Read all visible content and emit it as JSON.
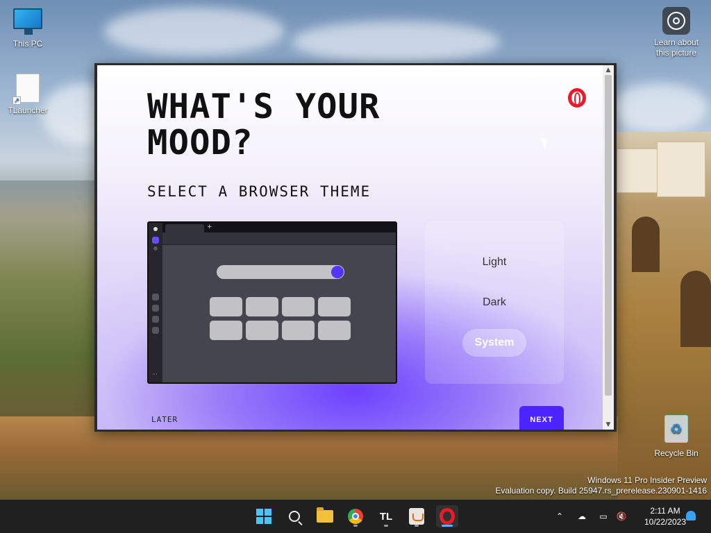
{
  "desktop": {
    "icons": [
      {
        "label": "This PC",
        "icon": "computer-icon"
      },
      {
        "label": "TLauncher",
        "icon": "file-shortcut-icon"
      },
      {
        "label": "Learn about this picture",
        "icon": "camera-info-icon"
      },
      {
        "label": "Recycle Bin",
        "icon": "recycle-bin-icon"
      }
    ],
    "watermark": {
      "line1": "Windows 11 Pro Insider Preview",
      "line2": "Evaluation copy. Build 25947.rs_prerelease.230901-1416"
    }
  },
  "onboarding": {
    "title": "WHAT'S YOUR MOOD?",
    "subtitle": "SELECT A BROWSER THEME",
    "themes": [
      "Light",
      "Dark",
      "System"
    ],
    "selected_theme": "System",
    "later_label": "LATER",
    "next_label": "NEXT",
    "accent_color": "#4b24ff",
    "logo": "opera-logo-icon"
  },
  "taskbar": {
    "apps": [
      "start-icon",
      "search-icon",
      "file-explorer-icon",
      "chrome-icon",
      "tlauncher-icon",
      "java-icon",
      "opera-icon"
    ],
    "active_app": "opera-icon",
    "time": "2:11 AM",
    "date": "10/22/2023"
  }
}
